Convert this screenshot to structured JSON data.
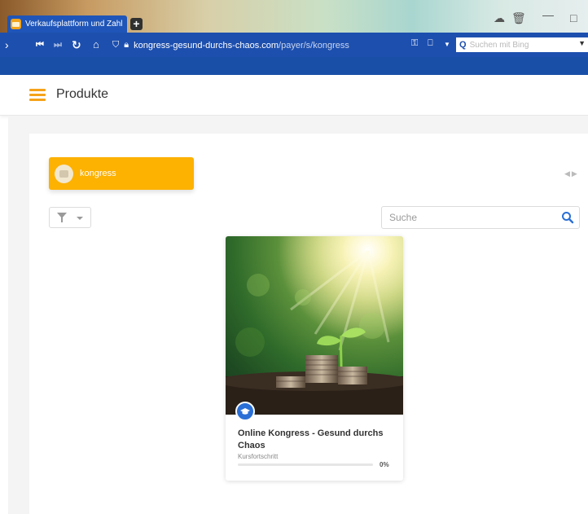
{
  "browser": {
    "tab_title": "Verkaufsplattform und Zahl",
    "url_host": "kongress-gesund-durchs-chaos.com",
    "url_path": "/payer/s/kongress",
    "search_placeholder": "Suchen mit Bing"
  },
  "header": {
    "title": "Produkte"
  },
  "category_chip": {
    "label": "kongress"
  },
  "search": {
    "placeholder": "Suche"
  },
  "product_card": {
    "title": "Online Kongress - Gesund durchs Chaos",
    "progress_label": "Kursfortschritt",
    "progress_value": 0,
    "progress_text": "0%"
  },
  "colors": {
    "accent": "#fdb100",
    "brand_blue": "#1d4fae",
    "badge_blue": "#2a6fd6"
  }
}
